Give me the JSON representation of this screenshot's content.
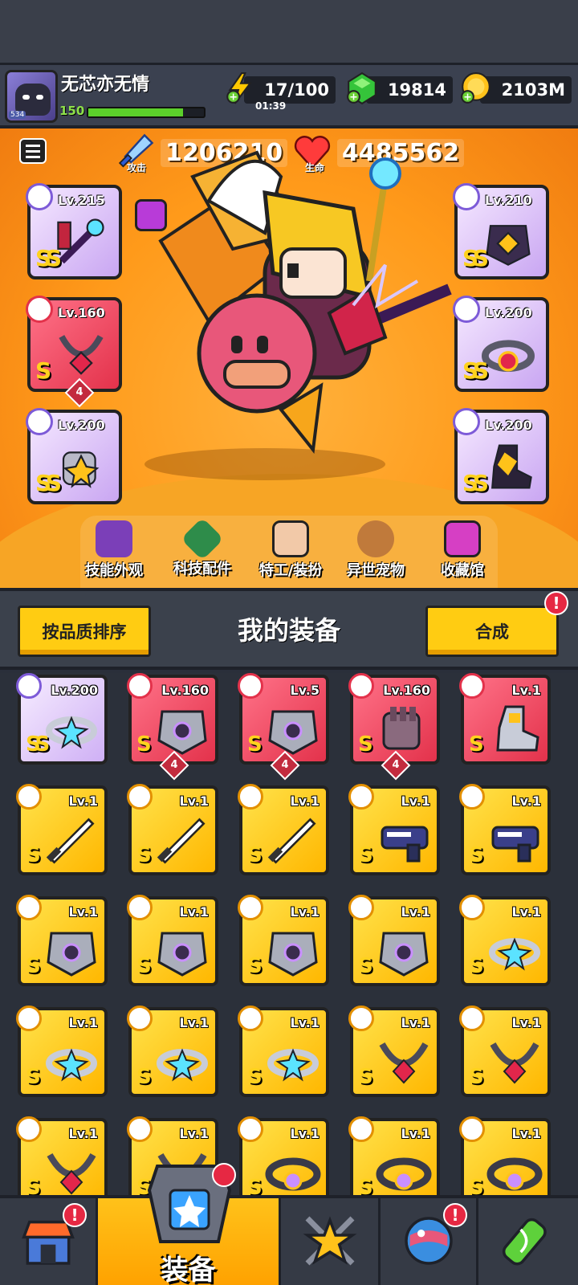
{
  "player": {
    "name": "无芯亦无情",
    "level": "150",
    "avatar_level": "534",
    "xp_fraction": 0.82
  },
  "resources": {
    "energy": {
      "value": "17/100",
      "timer": "01:39",
      "icon": "lightning-icon"
    },
    "gems": {
      "value": "19814",
      "icon": "green-gem-icon"
    },
    "coins": {
      "value": "2103M",
      "icon": "gold-coin-icon"
    }
  },
  "stats": {
    "attack": {
      "label": "攻击",
      "value": "1206210"
    },
    "hp": {
      "label": "生命",
      "value": "4485562"
    }
  },
  "equipped": [
    {
      "level": "Lv.215",
      "grade": "SS",
      "rarity": "ss",
      "type": "weapon"
    },
    {
      "level": "Lv.160",
      "grade": "S",
      "rarity": "s",
      "type": "necklace",
      "stars": "4"
    },
    {
      "level": "Lv.200",
      "grade": "SS",
      "rarity": "ss",
      "type": "gloves"
    },
    {
      "level": "Lv.210",
      "grade": "SS",
      "rarity": "ss",
      "type": "armor"
    },
    {
      "level": "Lv.200",
      "grade": "SS",
      "rarity": "ss",
      "type": "belt"
    },
    {
      "level": "Lv.200",
      "grade": "SS",
      "rarity": "ss",
      "type": "boots"
    }
  ],
  "nav": [
    {
      "label": "技能外观",
      "icon": "skill-skin-icon"
    },
    {
      "label": "科技配件",
      "icon": "tech-part-icon"
    },
    {
      "label": "特工/装扮",
      "icon": "agent-icon"
    },
    {
      "label": "异世宠物",
      "icon": "pet-icon"
    },
    {
      "label": "收藏馆",
      "icon": "collection-icon"
    }
  ],
  "equip_bar": {
    "sort_label": "按品质排序",
    "title": "我的装备",
    "merge_label": "合成",
    "alert": "!"
  },
  "inventory": [
    [
      {
        "level": "Lv.200",
        "grade": "SS",
        "color": "purple",
        "type": "ring"
      },
      {
        "level": "Lv.160",
        "grade": "S",
        "color": "red",
        "type": "armor",
        "stars": "4"
      },
      {
        "level": "Lv.5",
        "grade": "S",
        "color": "red",
        "type": "armor",
        "stars": "4"
      },
      {
        "level": "Lv.160",
        "grade": "S",
        "color": "red",
        "type": "gloves",
        "stars": "4"
      },
      {
        "level": "Lv.1",
        "grade": "S",
        "color": "red",
        "type": "boots"
      }
    ],
    [
      {
        "level": "Lv.1",
        "grade": "S",
        "color": "yellow",
        "type": "sword"
      },
      {
        "level": "Lv.1",
        "grade": "S",
        "color": "yellow",
        "type": "sword"
      },
      {
        "level": "Lv.1",
        "grade": "S",
        "color": "yellow",
        "type": "sword"
      },
      {
        "level": "Lv.1",
        "grade": "S",
        "color": "yellow",
        "type": "gun"
      },
      {
        "level": "Lv.1",
        "grade": "S",
        "color": "yellow",
        "type": "gun"
      }
    ],
    [
      {
        "level": "Lv.1",
        "grade": "S",
        "color": "yellow",
        "type": "armor"
      },
      {
        "level": "Lv.1",
        "grade": "S",
        "color": "yellow",
        "type": "armor"
      },
      {
        "level": "Lv.1",
        "grade": "S",
        "color": "yellow",
        "type": "armor"
      },
      {
        "level": "Lv.1",
        "grade": "S",
        "color": "yellow",
        "type": "armor"
      },
      {
        "level": "Lv.1",
        "grade": "S",
        "color": "yellow",
        "type": "ring"
      }
    ],
    [
      {
        "level": "Lv.1",
        "grade": "S",
        "color": "yellow",
        "type": "ring"
      },
      {
        "level": "Lv.1",
        "grade": "S",
        "color": "yellow",
        "type": "ring"
      },
      {
        "level": "Lv.1",
        "grade": "S",
        "color": "yellow",
        "type": "ring"
      },
      {
        "level": "Lv.1",
        "grade": "S",
        "color": "yellow",
        "type": "necklace"
      },
      {
        "level": "Lv.1",
        "grade": "S",
        "color": "yellow",
        "type": "necklace"
      }
    ],
    [
      {
        "level": "Lv.1",
        "grade": "S",
        "color": "yellow",
        "type": "necklace"
      },
      {
        "level": "Lv.1",
        "grade": "S",
        "color": "yellow",
        "type": "necklace"
      },
      {
        "level": "Lv.1",
        "grade": "S",
        "color": "yellow",
        "type": "belt"
      },
      {
        "level": "Lv.1",
        "grade": "S",
        "color": "yellow",
        "type": "belt"
      },
      {
        "level": "Lv.1",
        "grade": "S",
        "color": "yellow",
        "type": "belt"
      }
    ]
  ],
  "bottom_nav": [
    {
      "label": "",
      "icon": "shop-icon",
      "alert": "!"
    },
    {
      "label": "装备",
      "icon": "equipment-icon",
      "active": true
    },
    {
      "label": "",
      "icon": "battle-star-icon"
    },
    {
      "label": "",
      "icon": "planet-icon",
      "alert": "!"
    },
    {
      "label": "",
      "icon": "dna-icon"
    }
  ],
  "colors": {
    "accent": "#ffcc12",
    "arena": "#ff9a1a",
    "alert": "#e62843"
  }
}
